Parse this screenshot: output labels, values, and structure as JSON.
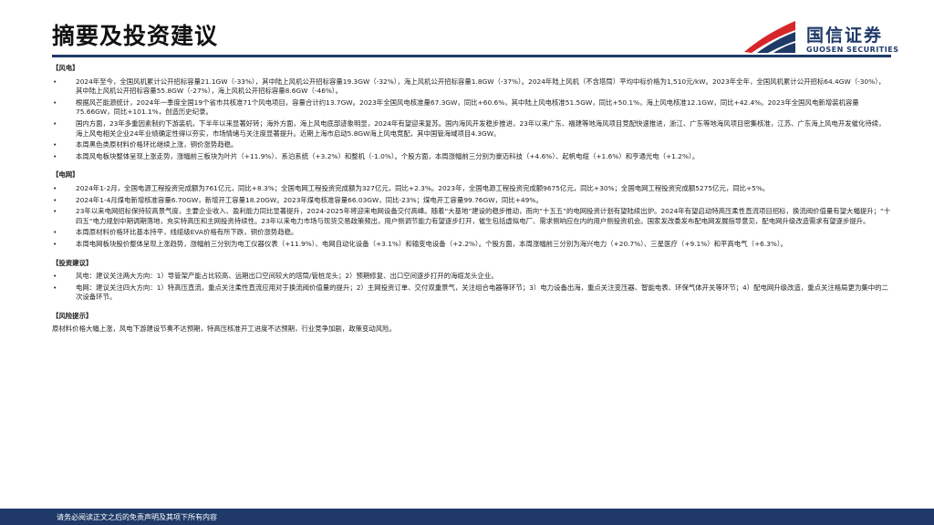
{
  "header": {
    "title": "摘要及投资建议",
    "logo_cn": "国信证券",
    "logo_en": "GUOSEN SECURITIES"
  },
  "sections": {
    "wind": {
      "heading": "【风电】",
      "items": [
        "2024年至今，全国风机累计公开招标容量21.1GW（-33%），其中陆上风机公开招标容量19.3GW（-32%），海上风机公开招标容量1.8GW（-37%）。2024年陆上风机（不含塔筒）平均中标价格为1,510元/kW。2023年全年，全国风机累计公开招标64.4GW（-30%），其中陆上风机公开招标容量55.8GW（-27%），海上风机公开招标容量8.6GW（-46%）。",
        "根据风芒能源统计，2024年一季度全国19个省市共核准71个风电项目，容量合计约13.7GW。2023年全国风电核准量67.3GW，同比+60.6%，其中陆上风电核准51.5GW，同比+50.1%，海上风电核准12.1GW，同比+42.4%。2023年全国风电新增装机容量75.66GW，同比+101.1%，创造历史纪录。",
        "国内方面，23年多重因素制约下游装机，下半年以来显著好转；海外方面，海上风电底部迹象明显，2024年有望迎来复苏。国内海风开发稳步推进，23年以来广东、福建等地海风项目竞配快速推进，浙江、广东等地海风项目密集核准，江苏、广东海上风电开发催化待续，海上风电相关企业24年业绩确定性得以夯实，市场情绪与关注度显著提升。近期上海市启动5.8GW海上风电竞配，其中国管海域项目4.3GW。",
        "本周黑色类原材料价格环比继续上涨，铜价涨势趋稳。",
        "本周风电板块整体呈现上涨走势，涨幅前三板块为叶片（+11.9%）、系泊系统（+3.2%）和整机（-1.0%）。个股方面，本周涨幅前三分别为豪迈科技（+4.6%）、起帆电缆（+1.6%）和亨通光电（+1.2%）。"
      ]
    },
    "grid": {
      "heading": "【电网】",
      "items": [
        "2024年1-2月，全国电源工程投资完成额为761亿元，同比+8.3%；全国电网工程投资完成额为327亿元，同比+2.3%。2023年，全国电源工程投资完成额9675亿元，同比+30%；全国电网工程投资完成额5275亿元，同比+5%。",
        "2024年1-4月煤电新增核准容量6.70GW，新增开工容量18.20GW。2023年煤电核准容量66.03GW，同比-23%；煤电开工容量99.76GW，同比+49%。",
        "23年以来电网招标保持较高景气度，主要企业收入、盈利能力同比显著提升，2024-2025年将迎来电网设备交付高峰。随着“大基地”建设的稳步推动，而向“十五五”的电网投资计划有望陆续出炉。2024年有望启动特高压柔性直流项目招标，换流阀价值量有望大幅提升；“十四五“电力规划中期调期落地，充实特高压和主网投资持续性。23年以来电力市场与现货交易政策频出，用户侧调节能力有望逐步打开，催生包括虚拟电厂、需求侧响应在内的用户侧投资机会。国家发改委发布配电网发展指导意见，配电网升级改造需求有望逐步提升。",
        "本周原材料价格环比基本持平，线缆级EVA价格有所下跌，铜价涨势趋稳。",
        "本周电网板块股价整体呈现上涨趋势，涨幅前三分别为电工仪器仪表（+11.9%）、电网自动化设备（+3.1%）和输变电设备（+2.2%）。个股方面，本周涨幅前三分别为海兴电力（+20.7%）、三星医疗（+9.1%）和平高电气（+6.3%）。"
      ]
    },
    "advice": {
      "heading": "【投资建议】",
      "items": [
        "风电：建议关注两大方向：1）导管架产能占比较高、远期出口空间较大的塔筒/管桩龙头；2）预期修复、出口空间逐步打开的海缆龙头企业。",
        "电网：建议关注四大方向：1）特高压直流，重点关注柔性直流应用对于换流阀价值量的提升；2）主网投资订单、交付双重景气，关注组合电器等环节；3）电力设备出海，重点关注变压器、智能电表、环保气体开关等环节；4）配电网升级改造，重点关注格局更为集中的二次设备环节。"
      ]
    },
    "risk": {
      "heading": "【风险提示】",
      "text": "原材料价格大幅上涨，风电下游建设节奏不达预期，特高压核准开工进度不达预期，行业竞争加剧，政策变动风险。"
    }
  },
  "footer": {
    "text": "请务必阅读正文之后的免责声明及其项下所有内容"
  },
  "colors": {
    "brand_navy": "#1f3a68",
    "brand_red": "#d7262a"
  }
}
